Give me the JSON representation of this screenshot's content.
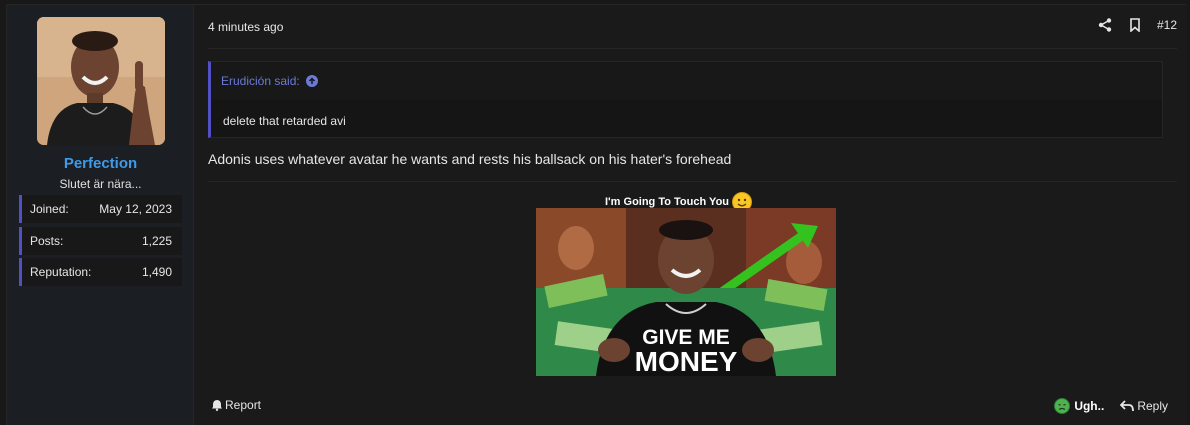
{
  "user": {
    "name": "Perfection",
    "title": "Slutet är nära...",
    "stats": [
      {
        "label": "Joined:",
        "value": "May 12, 2023"
      },
      {
        "label": "Posts:",
        "value": "1,225"
      },
      {
        "label": "Reputation:",
        "value": "1,490"
      }
    ]
  },
  "post": {
    "time": "4 minutes ago",
    "number": "#12",
    "quote": {
      "attribution": "Erudición said:",
      "body": "delete that retarded avi"
    },
    "message": "Adonis uses whatever avatar he wants and rests his ballsack on his hater's forehead",
    "embed": {
      "caption": "I'm Going To Touch You",
      "overlay_line1": "GIVE ME",
      "overlay_line2": "MONEY"
    }
  },
  "footer": {
    "report": "Report",
    "reaction": "Ugh..",
    "reply": "Reply"
  },
  "colors": {
    "accent": "#5151c5",
    "username": "#3f9bea",
    "quote_link": "#6b7ad6"
  }
}
